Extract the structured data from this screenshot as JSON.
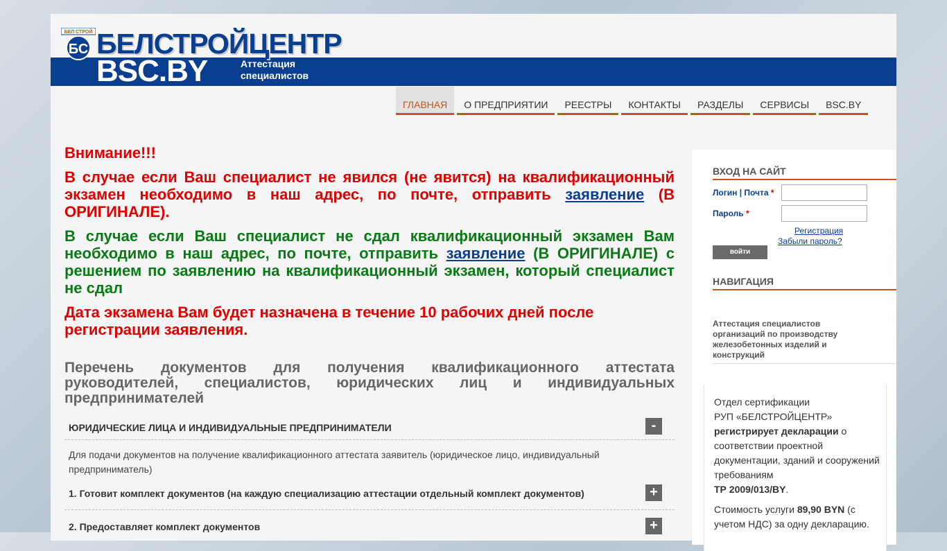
{
  "header": {
    "badge_top_text": "БЕЛ СТРОЙ",
    "badge_letters": "БС",
    "brand_top": "БЕЛСТРОЙЦЕНТР",
    "brand_bottom": "BSC.BY",
    "brand_sub_line1": "Аттестация",
    "brand_sub_line2": "специалистов"
  },
  "nav": {
    "items": [
      {
        "label": "ГЛАВНАЯ"
      },
      {
        "label": "О ПРЕДПРИЯТИИ"
      },
      {
        "label": "РЕЕСТРЫ"
      },
      {
        "label": "КОНТАКТЫ"
      },
      {
        "label": "РАЗДЕЛЫ"
      },
      {
        "label": "СЕРВИСЫ"
      },
      {
        "label": "BSC.BY"
      }
    ],
    "active_index": 0
  },
  "notice": {
    "attention": "Внимание!!!",
    "p1_before": "В случае если Ваш специалист не явился (не явится) на квалификационный экзамен необходимо в наш адрес, по почте, отправить ",
    "p1_link": "заявление",
    "p1_after": " (В ОРИГИНАЛЕ).",
    "p2_before": "В случае если Ваш специалист не сдал квалификационный экзамен Вам необходимо в наш адрес, по почте, отправить ",
    "p2_link": "заявление",
    "p2_after": " (В ОРИГИНАЛЕ) с решением по заявлению на квалификационный экзамен, который специалист не сдал",
    "p3": "Дата экзамена Вам будет назначена в течение 10 рабочих дней после регистрации заявления."
  },
  "documents": {
    "heading": "Перечень документов для получения квалификационного аттестата руководителей, специалистов, юридических лиц и индивидуальных предпринимателей",
    "section_title": "ЮРИДИЧЕСКИЕ ЛИЦА И ИНДИВИДУАЛЬНЫЕ ПРЕДПРИНИМАТЕЛИ",
    "section_toggle": "-",
    "section_intro": "Для подачи документов на получение квалификационного аттестата заявитель (юридическое лицо, индивидуальный предприниматель)",
    "steps": [
      {
        "label": "1. Готовит комплект документов (на каждую специализацию аттестации отдельный комплект документов)",
        "toggle": "+"
      },
      {
        "label": "2. Предоставляет комплект документов",
        "toggle": "+"
      }
    ]
  },
  "sidebar": {
    "login_title": "ВХОД НА САЙТ",
    "login_label": "Логин | Почта",
    "password_label": "Пароль",
    "required_mark": "*",
    "login_button": "войти",
    "register_link": "Регистрация",
    "forgot_link": "Забыли пароль?",
    "navigation_title": "НАВИГАЦИЯ",
    "navigation_link": "Аттестация специалистов организаций по производству железобетонных изделий и конструкций",
    "cert": {
      "line1": "Отдел сертификации",
      "line2": "РУП «БЕЛСТРОЙЦЕНТР»",
      "bold1": "регистрирует декларации",
      "rest1": " о соответствии проектной документации, зданий и сооружений требованиям",
      "tr": "ТР 2009/013/BY",
      "tr_after": ".",
      "cost_before": "Стоимость услуги ",
      "cost_value": "89,90 BYN",
      "cost_after": " (с учетом НДС) за одну декларацию."
    }
  }
}
